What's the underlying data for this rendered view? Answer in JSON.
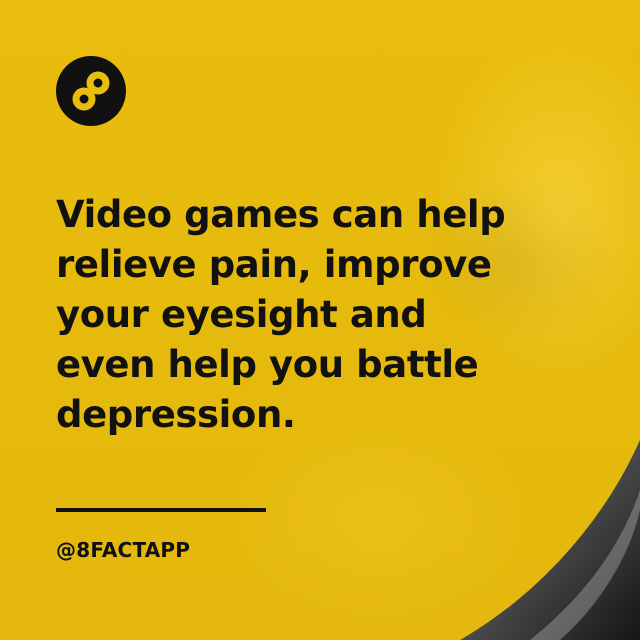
{
  "post": {
    "headline": "Video games can help relieve pain, improve your eyesight and even help you battle depression.",
    "handle": "@8FACTAPP"
  },
  "logo": {
    "icon": "infinity-8-icon"
  },
  "colors": {
    "background": "#e9bd0d",
    "text": "#111111",
    "logo_circle": "#111111",
    "logo_mark": "#e9bd0d"
  }
}
